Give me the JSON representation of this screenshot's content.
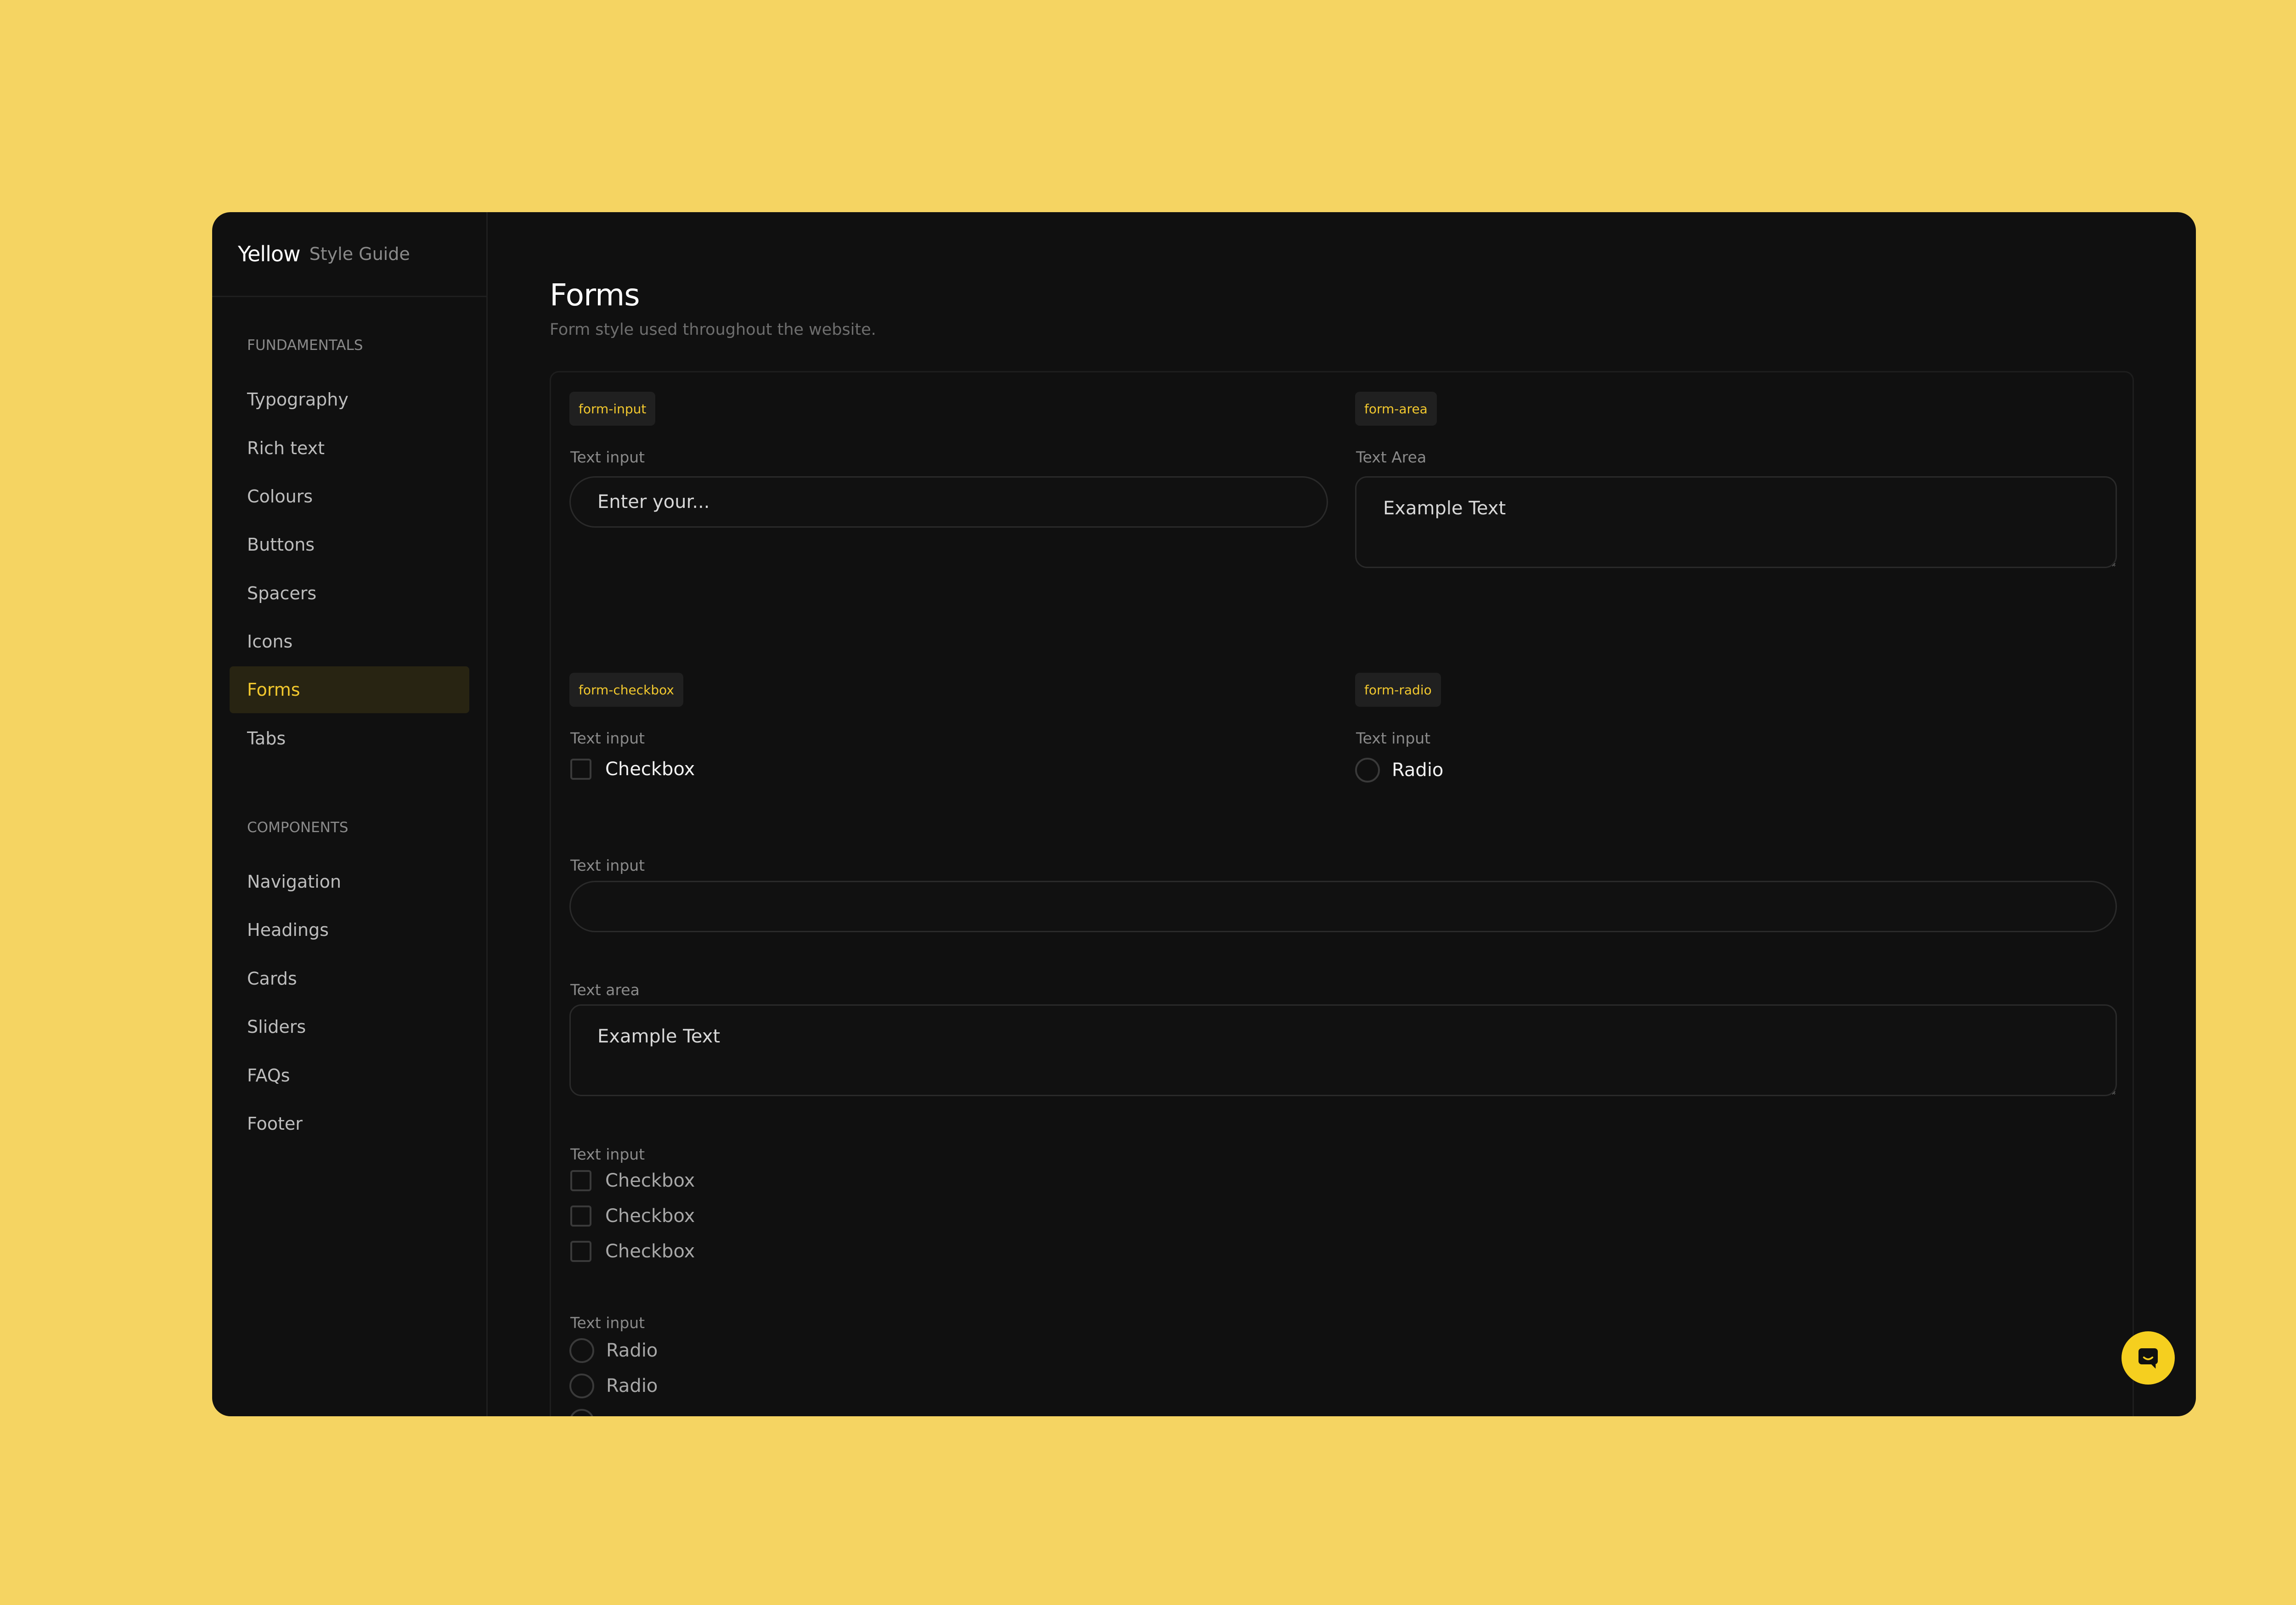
{
  "brand": {
    "name": "Yellow",
    "subtitle": "Style Guide"
  },
  "sidebar": {
    "sections": [
      {
        "title": "FUNDAMENTALS",
        "items": [
          {
            "label": "Typography"
          },
          {
            "label": "Rich text"
          },
          {
            "label": "Colours"
          },
          {
            "label": "Buttons"
          },
          {
            "label": "Spacers"
          },
          {
            "label": "Icons"
          },
          {
            "label": "Forms",
            "active": true
          },
          {
            "label": "Tabs"
          }
        ]
      },
      {
        "title": "COMPONENTS",
        "items": [
          {
            "label": "Navigation"
          },
          {
            "label": "Headings"
          },
          {
            "label": "Cards"
          },
          {
            "label": "Sliders"
          },
          {
            "label": "FAQs"
          },
          {
            "label": "Footer"
          }
        ]
      }
    ]
  },
  "page": {
    "title": "Forms",
    "subtitle": "Form style used throughout the website."
  },
  "demo": {
    "input": {
      "tag": "form-input",
      "label": "Text input",
      "placeholder": "Enter your..."
    },
    "area": {
      "tag": "form-area",
      "label": "Text Area",
      "value": "Example Text"
    },
    "checkbox": {
      "tag": "form-checkbox",
      "label": "Text input",
      "option": "Checkbox"
    },
    "radio": {
      "tag": "form-radio",
      "label": "Text input",
      "option": "Radio"
    }
  },
  "full_form": {
    "input_label": "Text input",
    "input_value": "",
    "area_label": "Text area",
    "area_value": "Example Text",
    "checkbox_group": {
      "label": "Text input",
      "options": [
        "Checkbox",
        "Checkbox",
        "Checkbox"
      ]
    },
    "radio_group": {
      "label": "Text input",
      "options": [
        "Radio",
        "Radio"
      ]
    }
  },
  "colors": {
    "accent": "#f2c82e",
    "background": "#f5d462",
    "surface": "#101010"
  },
  "chat": {
    "icon": "chat-icon"
  }
}
